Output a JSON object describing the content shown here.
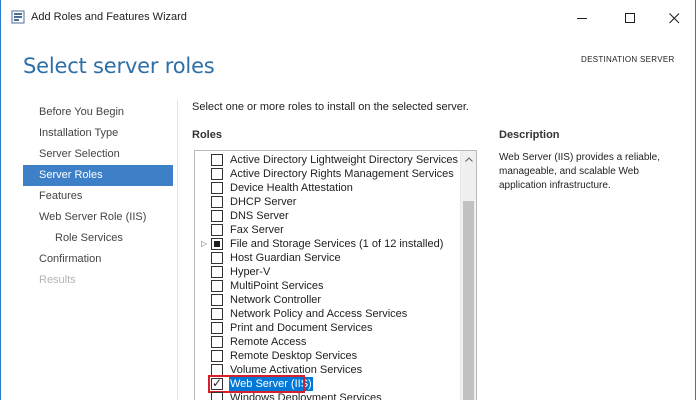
{
  "window": {
    "title": "Add Roles and Features Wizard"
  },
  "header": {
    "title": "Select server roles",
    "destination_label": "DESTINATION SERVER"
  },
  "nav": {
    "items": [
      {
        "label": "Before You Begin",
        "state": "normal"
      },
      {
        "label": "Installation Type",
        "state": "normal"
      },
      {
        "label": "Server Selection",
        "state": "normal"
      },
      {
        "label": "Server Roles",
        "state": "active"
      },
      {
        "label": "Features",
        "state": "normal"
      },
      {
        "label": "Web Server Role (IIS)",
        "state": "normal"
      },
      {
        "label": "Role Services",
        "state": "sub"
      },
      {
        "label": "Confirmation",
        "state": "normal"
      },
      {
        "label": "Results",
        "state": "disabled"
      }
    ]
  },
  "main": {
    "instruction": "Select one or more roles to install on the selected server.",
    "roles_heading": "Roles",
    "roles": [
      {
        "label": "Active Directory Lightweight Directory Services",
        "state": "unchecked"
      },
      {
        "label": "Active Directory Rights Management Services",
        "state": "unchecked"
      },
      {
        "label": "Device Health Attestation",
        "state": "unchecked"
      },
      {
        "label": "DHCP Server",
        "state": "unchecked"
      },
      {
        "label": "DNS Server",
        "state": "unchecked"
      },
      {
        "label": "Fax Server",
        "state": "unchecked"
      },
      {
        "label": "File and Storage Services (1 of 12 installed)",
        "state": "partial",
        "expandable": true
      },
      {
        "label": "Host Guardian Service",
        "state": "unchecked"
      },
      {
        "label": "Hyper-V",
        "state": "unchecked"
      },
      {
        "label": "MultiPoint Services",
        "state": "unchecked"
      },
      {
        "label": "Network Controller",
        "state": "unchecked"
      },
      {
        "label": "Network Policy and Access Services",
        "state": "unchecked"
      },
      {
        "label": "Print and Document Services",
        "state": "unchecked"
      },
      {
        "label": "Remote Access",
        "state": "unchecked"
      },
      {
        "label": "Remote Desktop Services",
        "state": "unchecked"
      },
      {
        "label": "Volume Activation Services",
        "state": "unchecked"
      },
      {
        "label": "Web Server (IIS)",
        "state": "checked",
        "selected": true
      },
      {
        "label": "Windows Deployment Services",
        "state": "unchecked"
      }
    ]
  },
  "description": {
    "heading": "Description",
    "text": "Web Server (IIS) provides a reliable, manageable, and scalable Web application infrastructure."
  },
  "icons": {
    "app": "server-manager-icon",
    "minimize": "minimize-icon",
    "maximize": "maximize-icon",
    "close": "close-icon",
    "scroll_up": "chevron-up-icon",
    "expander": "triangle-right-icon"
  },
  "colors": {
    "accent": "#3d80c8",
    "title": "#2e6fa8",
    "selection": "#0078d7",
    "highlight": "#d9202a"
  }
}
